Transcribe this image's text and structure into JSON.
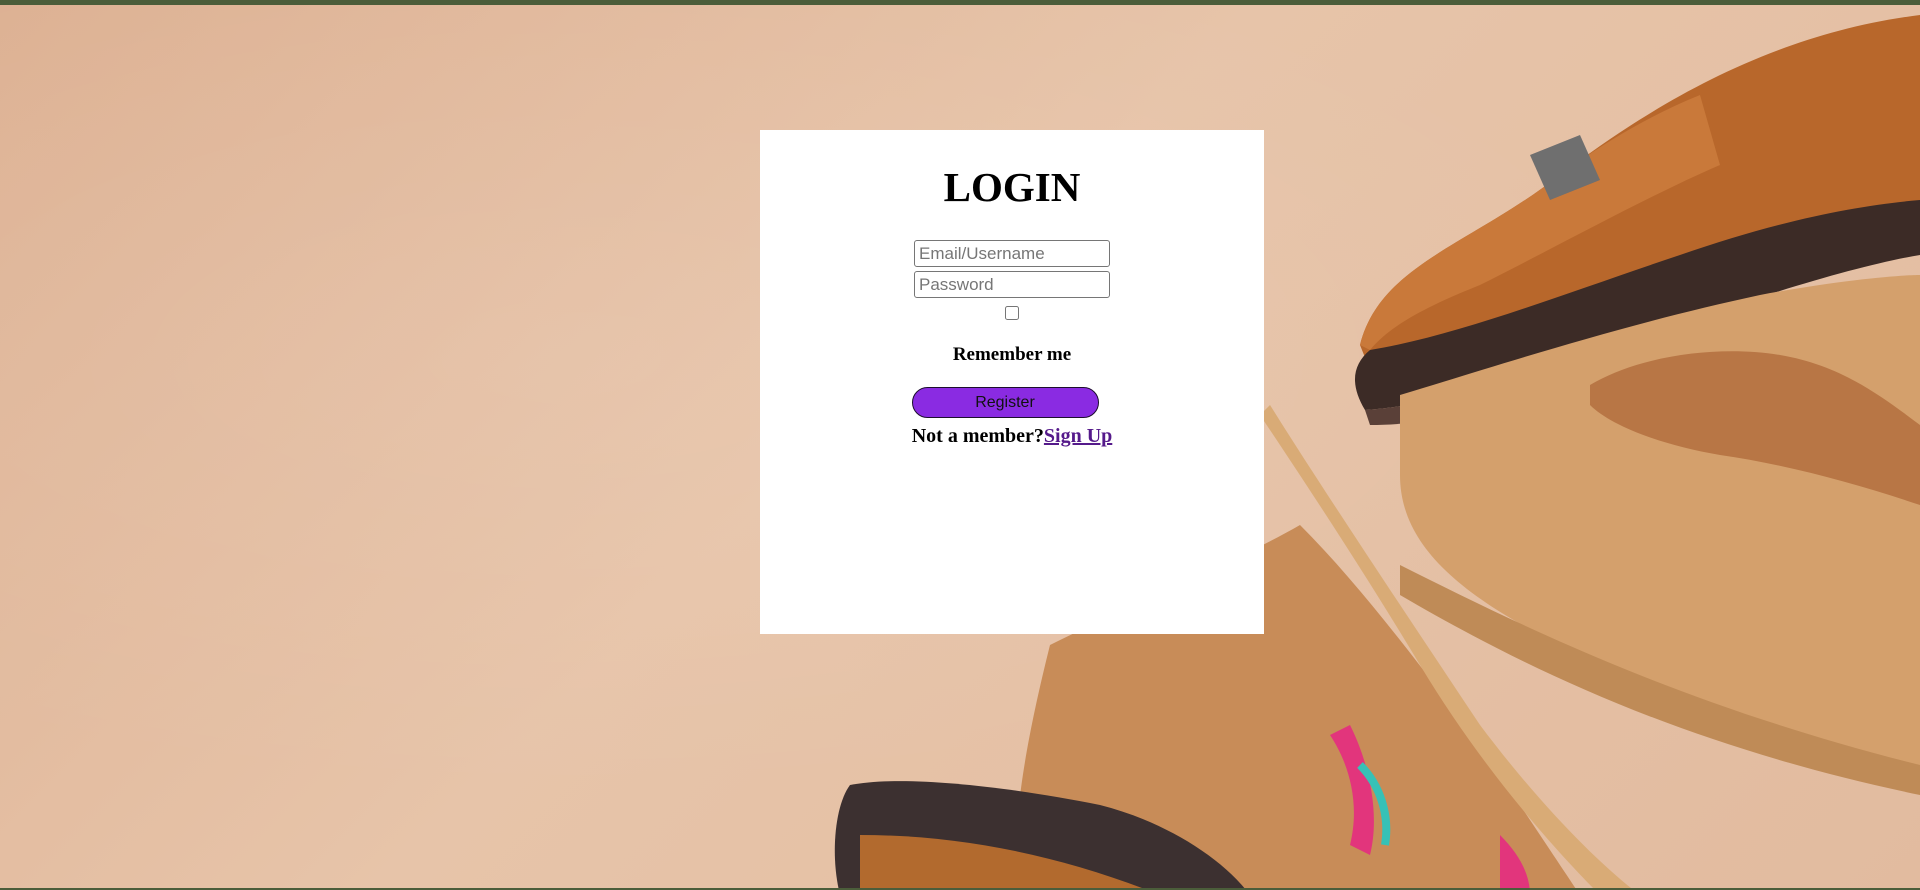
{
  "login": {
    "title": "LOGIN",
    "email_placeholder": "Email/Username",
    "password_placeholder": "Password",
    "remember_label": "Remember me",
    "register_label": "Register",
    "not_member_text": "Not a member?",
    "signup_label": "Sign Up"
  },
  "colors": {
    "frame_bar": "#4b5d3a",
    "background": "#e6bfa3",
    "button": "#8a2be2",
    "link": "#551a8b"
  }
}
